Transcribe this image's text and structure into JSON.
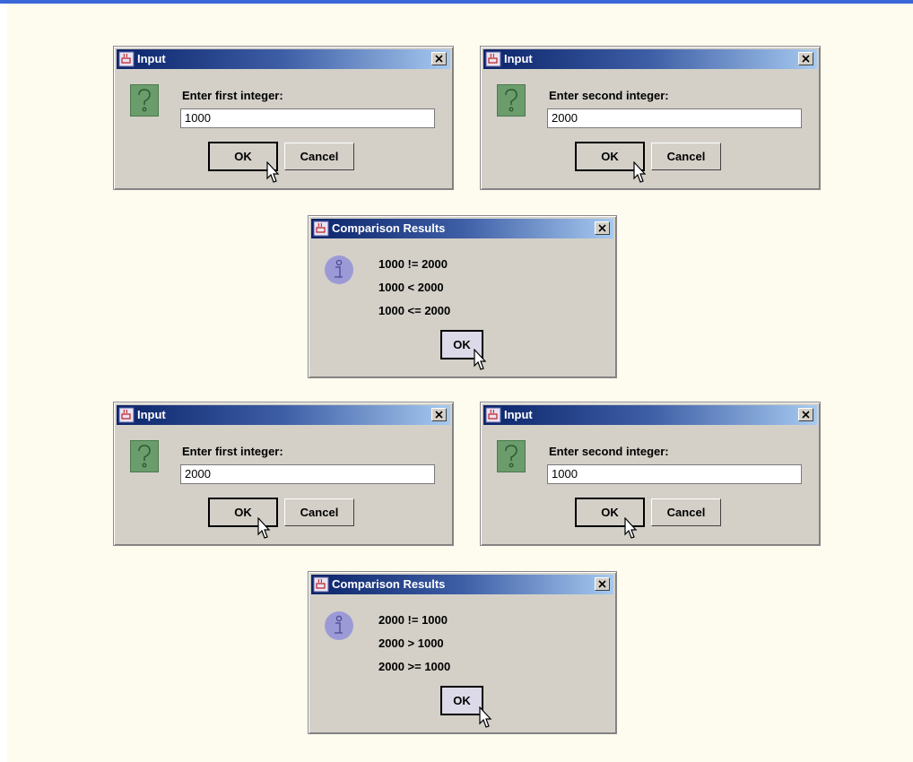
{
  "colors": {
    "title_gradient_start": "#0a246a",
    "title_gradient_end": "#a6caf0",
    "dialog_bg": "#d4d0c8",
    "question_icon": "#6a9c6c",
    "info_icon": "#9c9ad6",
    "canvas_bg": "#fefbef",
    "top_rule": "#3a67d8"
  },
  "icons": {
    "app": "java-cup-icon",
    "close": "close-icon",
    "question": "question-icon",
    "info": "info-icon",
    "cursor": "mouse-pointer-icon"
  },
  "input_dialogs": [
    {
      "title": "Input",
      "prompt": "Enter first integer:",
      "value": "1000",
      "ok_label": "OK",
      "cancel_label": "Cancel"
    },
    {
      "title": "Input",
      "prompt": "Enter second integer:",
      "value": "2000",
      "ok_label": "OK",
      "cancel_label": "Cancel"
    },
    {
      "title": "Input",
      "prompt": "Enter first integer:",
      "value": "2000",
      "ok_label": "OK",
      "cancel_label": "Cancel"
    },
    {
      "title": "Input",
      "prompt": "Enter second integer:",
      "value": "1000",
      "ok_label": "OK",
      "cancel_label": "Cancel"
    }
  ],
  "result_dialogs": [
    {
      "title": "Comparison Results",
      "lines": [
        "1000 != 2000",
        "1000 < 2000",
        "1000 <= 2000"
      ],
      "ok_label": "OK"
    },
    {
      "title": "Comparison Results",
      "lines": [
        "2000 != 1000",
        "2000 > 1000",
        "2000 >= 1000"
      ],
      "ok_label": "OK"
    }
  ]
}
